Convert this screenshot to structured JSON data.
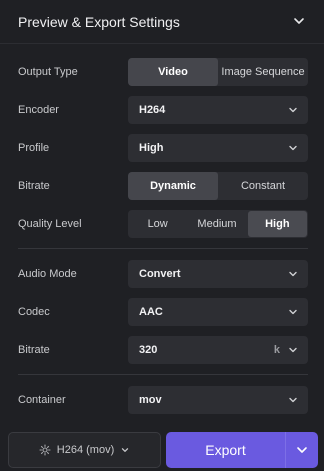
{
  "header": {
    "title": "Preview & Export Settings"
  },
  "output_type": {
    "label": "Output Type",
    "options": [
      "Video",
      "Image Sequence"
    ],
    "selected": "Video"
  },
  "encoder": {
    "label": "Encoder",
    "value": "H264"
  },
  "profile": {
    "label": "Profile",
    "value": "High"
  },
  "video_bitrate": {
    "label": "Bitrate",
    "options": [
      "Dynamic",
      "Constant"
    ],
    "selected": "Dynamic"
  },
  "quality": {
    "label": "Quality Level",
    "options": [
      "Low",
      "Medium",
      "High"
    ],
    "selected": "High"
  },
  "audio_mode": {
    "label": "Audio Mode",
    "value": "Convert"
  },
  "codec": {
    "label": "Codec",
    "value": "AAC"
  },
  "audio_bitrate": {
    "label": "Bitrate",
    "value": "320",
    "unit": "k"
  },
  "container": {
    "label": "Container",
    "value": "mov"
  },
  "footer": {
    "preset_label": "H264 (mov)",
    "export_label": "Export"
  },
  "colors": {
    "background": "#1f2024",
    "control": "#2d2e33",
    "active_segment": "#45464c",
    "accent": "#6a5ae0"
  },
  "icons": {
    "collapse": "chevron-down-icon",
    "preset": "gear-icon",
    "dropdown": "chevron-down-icon"
  }
}
